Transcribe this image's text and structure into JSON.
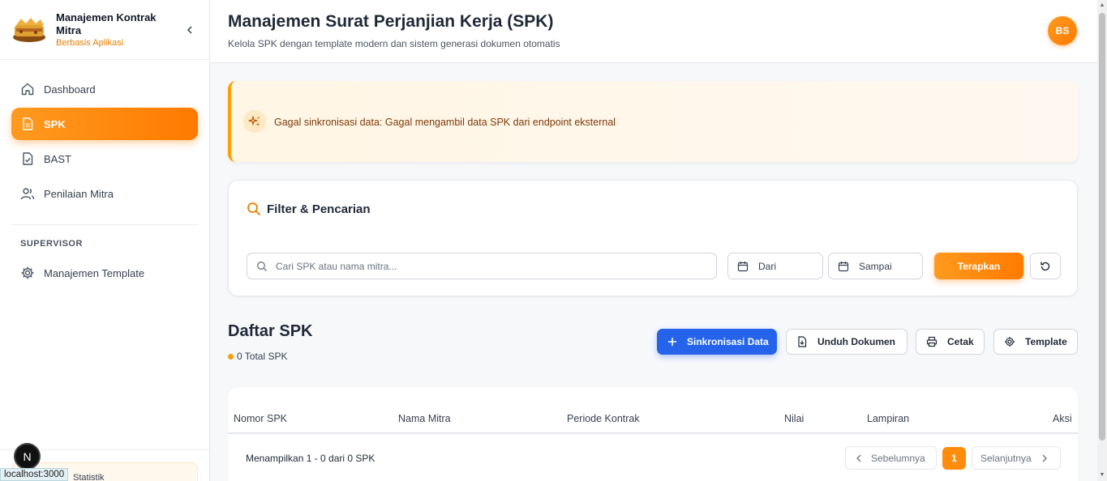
{
  "sidebar": {
    "brand_title": "Manajemen Kontrak Mitra",
    "brand_subtitle": "Berbasis Aplikasi",
    "items": [
      {
        "label": "Dashboard",
        "icon": "home-icon"
      },
      {
        "label": "SPK",
        "icon": "document-icon",
        "active": true
      },
      {
        "label": "BAST",
        "icon": "file-check-icon"
      },
      {
        "label": "Penilaian Mitra",
        "icon": "users-icon"
      }
    ],
    "section_label": "SUPERVISOR",
    "supervisor_items": [
      {
        "label": "Manajemen Template",
        "icon": "gear-icon"
      }
    ],
    "stat_label": "Statistik",
    "dev_badge": "N",
    "localhost": "localhost:3000"
  },
  "header": {
    "title": "Manajemen Surat Perjanjian Kerja (SPK)",
    "subtitle": "Kelola SPK dengan template modern dan sistem generasi dokumen otomatis",
    "avatar": "BS"
  },
  "alert": {
    "message": "Gagal sinkronisasi data: Gagal mengambil data SPK dari endpoint eksternal"
  },
  "filter": {
    "title": "Filter & Pencarian",
    "search_placeholder": "Cari SPK atau nama mitra...",
    "from_label": "Dari",
    "to_label": "Sampai",
    "apply_label": "Terapkan"
  },
  "list": {
    "title": "Daftar SPK",
    "total": "0 Total SPK",
    "actions": {
      "sync": "Sinkronisasi Data",
      "download": "Unduh Dokumen",
      "print": "Cetak",
      "template": "Template"
    }
  },
  "table": {
    "columns": [
      "Nomor SPK",
      "Nama Mitra",
      "Periode Kontrak",
      "Nilai",
      "Lampiran",
      "Aksi"
    ],
    "rows": [],
    "footer": "Menampilkan 1 - 0 dari 0 SPK",
    "prev_label": "Sebelumnya",
    "next_label": "Selanjutnya",
    "current_page": "1"
  },
  "colors": {
    "accent": "#ff8c0a",
    "primary_button": "#2563eb",
    "alert_border": "#ffa000"
  }
}
